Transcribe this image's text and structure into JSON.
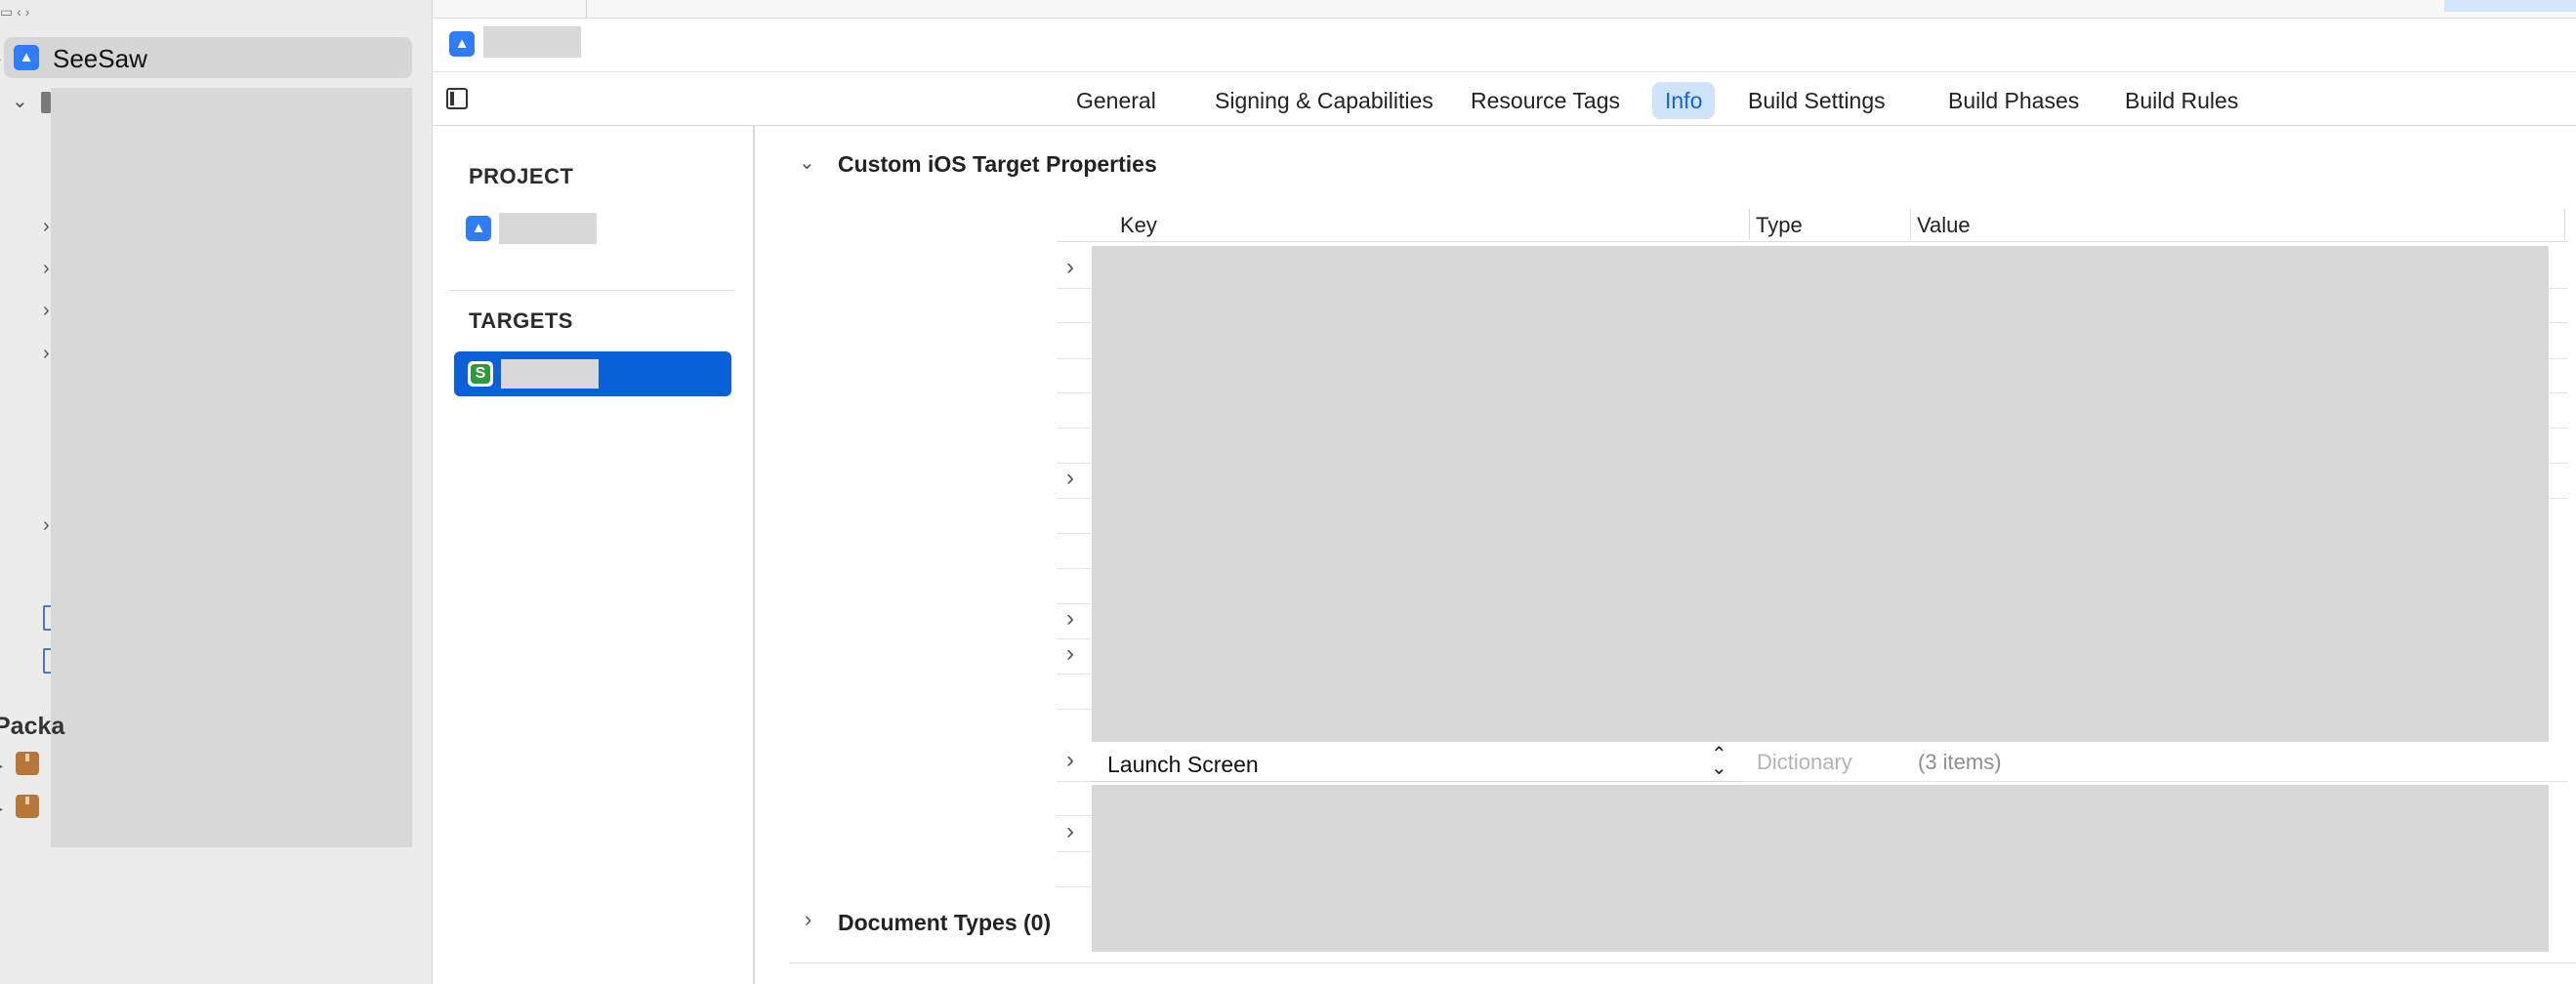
{
  "navigator": {
    "project_name": "SeeSaw",
    "packages_label": "Packa"
  },
  "tabs": [
    {
      "label": "General"
    },
    {
      "label": "Signing & Capabilities"
    },
    {
      "label": "Resource Tags"
    },
    {
      "label": "Info"
    },
    {
      "label": "Build Settings"
    },
    {
      "label": "Build Phases"
    },
    {
      "label": "Build Rules"
    }
  ],
  "targets_list": {
    "project_header": "PROJECT",
    "targets_header": "TARGETS"
  },
  "info": {
    "section_title": "Custom iOS Target Properties",
    "columns": {
      "key": "Key",
      "type": "Type",
      "value": "Value"
    },
    "visible_row": {
      "key": "Launch Screen",
      "type": "Dictionary",
      "value": "(3 items)"
    },
    "document_types": "Document Types (0)"
  },
  "colors": {
    "accent": "#0a60d8",
    "active_tab_bg": "#cfe3fb",
    "redaction": "#d8d8d8"
  }
}
